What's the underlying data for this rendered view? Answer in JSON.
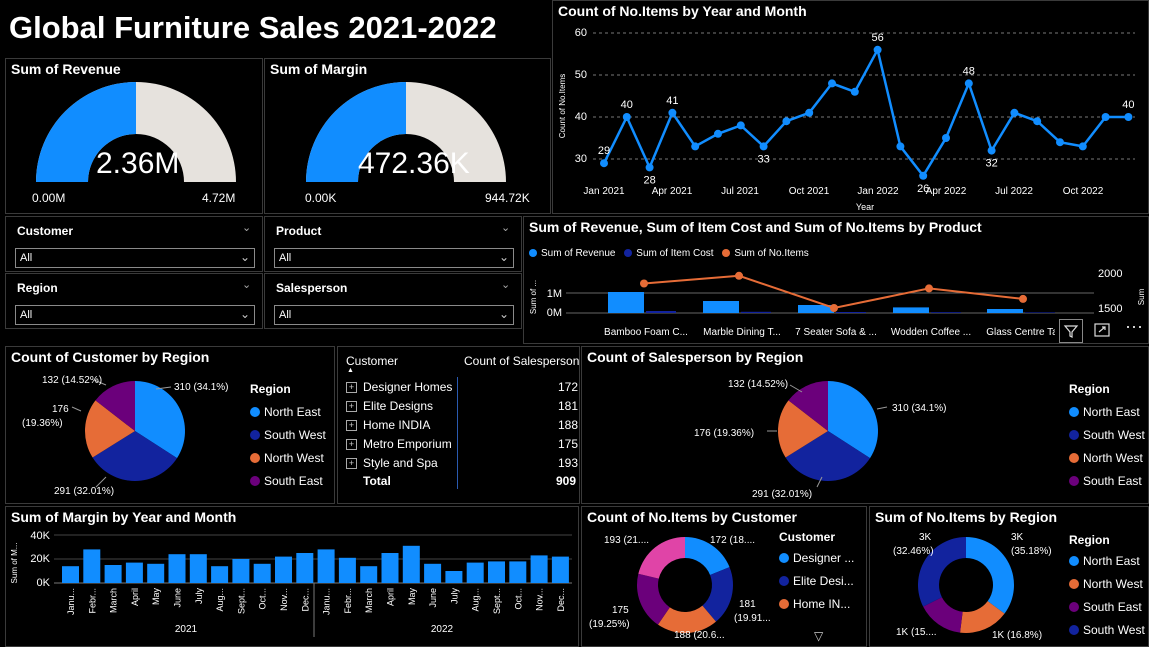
{
  "title": "Global Furniture Sales 2021-2022",
  "colors": {
    "blue": "#118dff",
    "navy": "#12239e",
    "orange": "#e66c37",
    "purple": "#6b007b",
    "pink": "#e044a7",
    "grey": "#e6e2dd"
  },
  "revenue_gauge": {
    "title": "Sum of Revenue",
    "value": "2.36M",
    "min": "0.00M",
    "max": "4.72M",
    "fraction": 0.5
  },
  "margin_gauge": {
    "title": "Sum of Margin",
    "value": "472.36K",
    "min": "0.00K",
    "max": "944.72K",
    "fraction": 0.5
  },
  "slicers": [
    {
      "label": "Customer",
      "value": "All"
    },
    {
      "label": "Product",
      "value": "All"
    },
    {
      "label": "Region",
      "value": "All"
    },
    {
      "label": "Salesperson",
      "value": "All"
    }
  ],
  "line_chart": {
    "title": "Count of No.Items by Year and Month",
    "ylabel": "Count of No.Items",
    "xlabel": "Year",
    "yticks": [
      "60",
      "50",
      "40",
      "30"
    ],
    "xticks": [
      "Jan 2021",
      "Apr 2021",
      "Jul 2021",
      "Oct 2021",
      "Jan 2022",
      "Apr 2022",
      "Jul 2022",
      "Oct 2022"
    ]
  },
  "combo_chart": {
    "title": "Sum of Revenue, Sum of Item Cost and Sum of No.Items by Product",
    "legend": [
      "Sum of Revenue",
      "Sum of Item Cost",
      "Sum of No.Items"
    ],
    "yleft": [
      "1M",
      "0M"
    ],
    "yright": [
      "2000",
      "1500"
    ],
    "yleft_label": "Sum of ...",
    "yright_label": "Sum",
    "categories": [
      "Bamboo Foam C...",
      "Marble Dining T...",
      "7 Seater Sofa & ...",
      "Wodden Coffee ...",
      "Glass Centre Ta"
    ]
  },
  "pie_customer_region": {
    "title": "Count of Customer by Region",
    "labels": [
      "310 (34.1%)",
      "291 (32.01%)",
      "176\n(19.36%)",
      "132 (14.52%)"
    ],
    "legend_title": "Region",
    "legend": [
      "North East",
      "South West",
      "North West",
      "South East"
    ]
  },
  "table": {
    "headers": [
      "Customer",
      "Count of Salesperson"
    ],
    "rows": [
      {
        "name": "Designer Homes",
        "value": "172"
      },
      {
        "name": "Elite Designs",
        "value": "181"
      },
      {
        "name": "Home INDIA",
        "value": "188"
      },
      {
        "name": "Metro Emporium",
        "value": "175"
      },
      {
        "name": "Style and Spa",
        "value": "193"
      }
    ],
    "total_label": "Total",
    "total_value": "909"
  },
  "pie_salesperson_region": {
    "title": "Count of Salesperson by Region",
    "labels": [
      "310 (34.1%)",
      "291 (32.01%)",
      "176 (19.36%)",
      "132 (14.52%)"
    ],
    "legend_title": "Region",
    "legend": [
      "North East",
      "South West",
      "North West",
      "South East"
    ]
  },
  "bar_margin": {
    "title": "Sum of Margin by Year and Month",
    "ylabel": "Sum of M...",
    "yticks": [
      "40K",
      "20K",
      "0K"
    ],
    "months": [
      "Janu...",
      "Febr...",
      "March",
      "April",
      "May",
      "June",
      "July",
      "Aug...",
      "Sept...",
      "Oct...",
      "Nov...",
      "Dec..."
    ],
    "years": [
      "2021",
      "2022"
    ]
  },
  "donut_customer": {
    "title": "Count of No.Items by Customer",
    "labels": [
      "172 (18....",
      "181\n(19.91...",
      "188 (20.6...",
      "175\n(19.25%)",
      "193 (21...."
    ],
    "legend_title": "Customer",
    "legend": [
      "Designer ...",
      "Elite Desi...",
      "Home IN..."
    ]
  },
  "donut_region": {
    "title": "Sum of No.Items by Region",
    "labels": [
      "3K\n(35.18%)",
      "1K (16.8%)",
      "1K (15....",
      "3K\n(32.46%)"
    ],
    "legend_title": "Region",
    "legend": [
      "North East",
      "North West",
      "South East",
      "South West"
    ]
  },
  "chart_data": [
    {
      "type": "line",
      "title": "Count of No.Items by Year and Month",
      "xlabel": "Year",
      "ylabel": "Count of No.Items",
      "ylim": [
        25,
        60
      ],
      "x": [
        "Jan 2021",
        "Feb 2021",
        "Mar 2021",
        "Apr 2021",
        "May 2021",
        "Jun 2021",
        "Jul 2021",
        "Aug 2021",
        "Sep 2021",
        "Oct 2021",
        "Nov 2021",
        "Dec 2021",
        "Jan 2022",
        "Feb 2022",
        "Mar 2022",
        "Apr 2022",
        "May 2022",
        "Jun 2022",
        "Jul 2022",
        "Aug 2022",
        "Sep 2022",
        "Oct 2022",
        "Nov 2022",
        "Dec 2022"
      ],
      "values": [
        29,
        40,
        28,
        41,
        33,
        36,
        38,
        33,
        39,
        41,
        48,
        46,
        56,
        33,
        26,
        35,
        48,
        32,
        41,
        39,
        34,
        33,
        40,
        40
      ],
      "labeled": {
        "0": "29",
        "1": "40",
        "2": "28",
        "3": "41",
        "7": "33",
        "12": "56",
        "14": "26",
        "16": "48",
        "17": "32",
        "23": "40"
      }
    },
    {
      "type": "bar",
      "title": "Sum of Revenue, Sum of Item Cost and Sum of No.Items by Product",
      "categories": [
        "Bamboo Foam C...",
        "Marble Dining T...",
        "7 Seater Sofa & ...",
        "Wodden Coffee ...",
        "Glass Centre Ta"
      ],
      "series": [
        {
          "name": "Sum of Revenue",
          "values": [
            1.05,
            0.6,
            0.4,
            0.28,
            0.2
          ]
        },
        {
          "name": "Sum of Item Cost",
          "values": [
            0.1,
            0.06,
            0.05,
            0.04,
            0.03
          ]
        },
        {
          "name": "Sum of No.Items",
          "values": [
            1850,
            1960,
            1500,
            1780,
            1630
          ]
        }
      ]
    },
    {
      "type": "pie",
      "title": "Count of Customer by Region",
      "categories": [
        "North East",
        "South West",
        "North West",
        "South East"
      ],
      "values": [
        310,
        291,
        176,
        132
      ]
    },
    {
      "type": "table",
      "title": "Customer / Count of Salesperson",
      "categories": [
        "Designer Homes",
        "Elite Designs",
        "Home INDIA",
        "Metro Emporium",
        "Style and Spa"
      ],
      "values": [
        172,
        181,
        188,
        175,
        193
      ]
    },
    {
      "type": "pie",
      "title": "Count of Salesperson by Region",
      "categories": [
        "North East",
        "South West",
        "North West",
        "South East"
      ],
      "values": [
        310,
        291,
        176,
        132
      ]
    },
    {
      "type": "bar",
      "title": "Sum of Margin by Year and Month",
      "ylim": [
        0,
        40000
      ],
      "values": [
        14000,
        28000,
        15000,
        17000,
        16000,
        24000,
        24000,
        14000,
        20000,
        16000,
        22000,
        25000,
        28000,
        21000,
        14000,
        25000,
        31000,
        16000,
        10000,
        17000,
        18000,
        18000,
        23000,
        22000
      ]
    },
    {
      "type": "pie",
      "title": "Count of No.Items by Customer",
      "categories": [
        "Designer Homes",
        "Elite Designs",
        "Home INDIA",
        "Metro Emporium",
        "Style and Spa"
      ],
      "values": [
        172,
        181,
        188,
        175,
        193
      ]
    },
    {
      "type": "pie",
      "title": "Sum of No.Items by Region",
      "categories": [
        "North East",
        "North West",
        "South East",
        "South West"
      ],
      "values": [
        35.18,
        16.8,
        15.56,
        32.46
      ]
    }
  ]
}
